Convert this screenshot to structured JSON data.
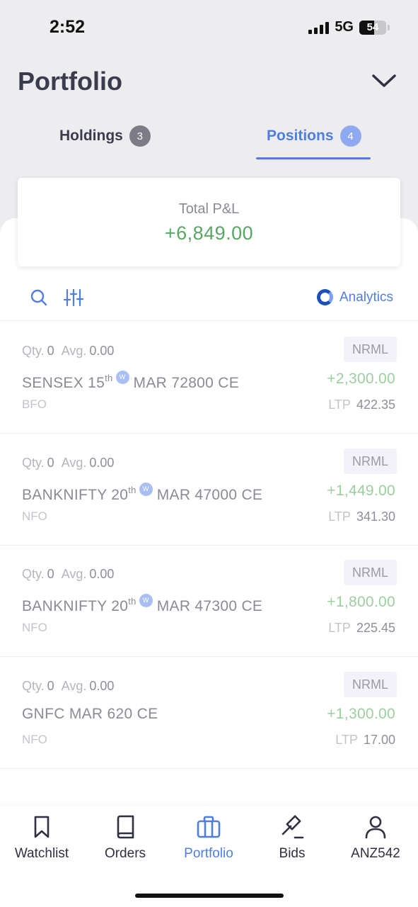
{
  "status_bar": {
    "time": "2:52",
    "network": "5G",
    "battery": "54"
  },
  "header": {
    "title": "Portfolio"
  },
  "tabs": [
    {
      "label": "Holdings",
      "count": "3",
      "active": false
    },
    {
      "label": "Positions",
      "count": "4",
      "active": true
    }
  ],
  "summary": {
    "label": "Total P&L",
    "value": "+6,849.00",
    "color": "#5aa563"
  },
  "toolbar": {
    "analytics_label": "Analytics"
  },
  "labels": {
    "qty": "Qty.",
    "avg": "Avg.",
    "ltp": "LTP",
    "weekly_marker": "W"
  },
  "positions": [
    {
      "qty": "0",
      "avg": "0.00",
      "product": "NRML",
      "symbol_prefix": "SENSEX 15",
      "symbol_sup": "th",
      "symbol_suffix": "MAR 72800 CE",
      "weekly": true,
      "pnl": "+2,300.00",
      "exchange": "BFO",
      "ltp": "422.35"
    },
    {
      "qty": "0",
      "avg": "0.00",
      "product": "NRML",
      "symbol_prefix": "BANKNIFTY 20",
      "symbol_sup": "th",
      "symbol_suffix": "MAR 47000 CE",
      "weekly": true,
      "pnl": "+1,449.00",
      "exchange": "NFO",
      "ltp": "341.30"
    },
    {
      "qty": "0",
      "avg": "0.00",
      "product": "NRML",
      "symbol_prefix": "BANKNIFTY 20",
      "symbol_sup": "th",
      "symbol_suffix": "MAR 47300 CE",
      "weekly": true,
      "pnl": "+1,800.00",
      "exchange": "NFO",
      "ltp": "225.45"
    },
    {
      "qty": "0",
      "avg": "0.00",
      "product": "NRML",
      "symbol_prefix": "GNFC MAR 620 CE",
      "symbol_sup": "",
      "symbol_suffix": "",
      "weekly": false,
      "pnl": "+1,300.00",
      "exchange": "NFO",
      "ltp": "17.00"
    }
  ],
  "bottom_nav": [
    {
      "label": "Watchlist",
      "icon": "bookmark-icon",
      "active": false
    },
    {
      "label": "Orders",
      "icon": "book-icon",
      "active": false
    },
    {
      "label": "Portfolio",
      "icon": "briefcase-icon",
      "active": true
    },
    {
      "label": "Bids",
      "icon": "gavel-icon",
      "active": false
    },
    {
      "label": "ANZ542",
      "icon": "user-icon",
      "active": false
    }
  ],
  "colors": {
    "accent": "#4f7ee0",
    "profit": "#5aa563",
    "profit_light": "#9ccf9e"
  }
}
